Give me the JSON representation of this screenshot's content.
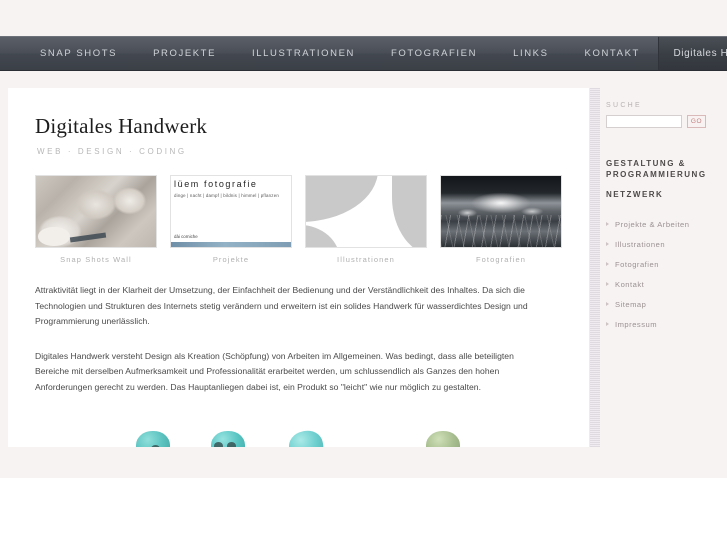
{
  "nav": {
    "items": [
      {
        "label": "SNAP SHOTS",
        "name": "nav-item-snap-shots"
      },
      {
        "label": "PROJEKTE",
        "name": "nav-item-projekte"
      },
      {
        "label": "ILLUSTRATIONEN",
        "name": "nav-item-illustrationen"
      },
      {
        "label": "FOTOGRAFIEN",
        "name": "nav-item-fotografien"
      },
      {
        "label": "LINKS",
        "name": "nav-item-links"
      },
      {
        "label": "KONTAKT",
        "name": "nav-item-kontakt"
      }
    ],
    "brand": "Digitales Handwerk"
  },
  "main": {
    "title": "Digitales Handwerk",
    "subtitle": "WEB · DESIGN · CODING",
    "thumbs": [
      {
        "caption": "Snap Shots Wall"
      },
      {
        "caption": "Projekte",
        "overlay_title": "lüem  fotografie",
        "overlay_sub": "dinge | nacht | dampf | bildnis | himmel | pflanzen",
        "overlay_foot": "dài corniche"
      },
      {
        "caption": "Illustrationen"
      },
      {
        "caption": "Fotografien"
      }
    ],
    "paragraphs": [
      "Attraktivität liegt in der Klarheit der Umsetzung, der Einfachheit der Bedienung und der Verständlichkeit des Inhaltes. Da sich die Technologien und Strukturen des Internets stetig verändern und erweitern ist ein solides Handwerk für wasserdichtes Design und Programmierung unerlässlich.",
      "Digitales Handwerk versteht Design als Kreation (Schöpfung) von Arbeiten im Allgemeinen. Was bedingt, dass alle beteiligten Bereiche mit derselben Aufmerksamkeit und Professionalität erarbeitet werden, um schlussendlich als Ganzes den hohen Anforderungen gerecht zu werden. Das Hauptanliegen dabei ist, ein Produkt so \"leicht\" wie nur möglich zu gestalten."
    ]
  },
  "sidebar": {
    "search_label": "SUCHE",
    "search_value": "",
    "search_placeholder": "",
    "go_label": "GO",
    "heading_1": "GESTALTUNG & PROGRAMMIERUNG",
    "heading_2": "NETZWERK",
    "links": [
      {
        "label": "Projekte & Arbeiten"
      },
      {
        "label": "Illustrationen"
      },
      {
        "label": "Fotografien"
      },
      {
        "label": "Kontakt"
      },
      {
        "label": "Sitemap"
      },
      {
        "label": "Impressum"
      }
    ]
  },
  "colors": {
    "page_background": "#f8f3f3",
    "nav_background": "#4a4f57",
    "nav_brand_background": "#3a3e45",
    "content_background": "#ffffff",
    "accent_go": "#c07f7f",
    "text_body": "#4a4a4a",
    "text_muted": "#b0b0b0"
  }
}
